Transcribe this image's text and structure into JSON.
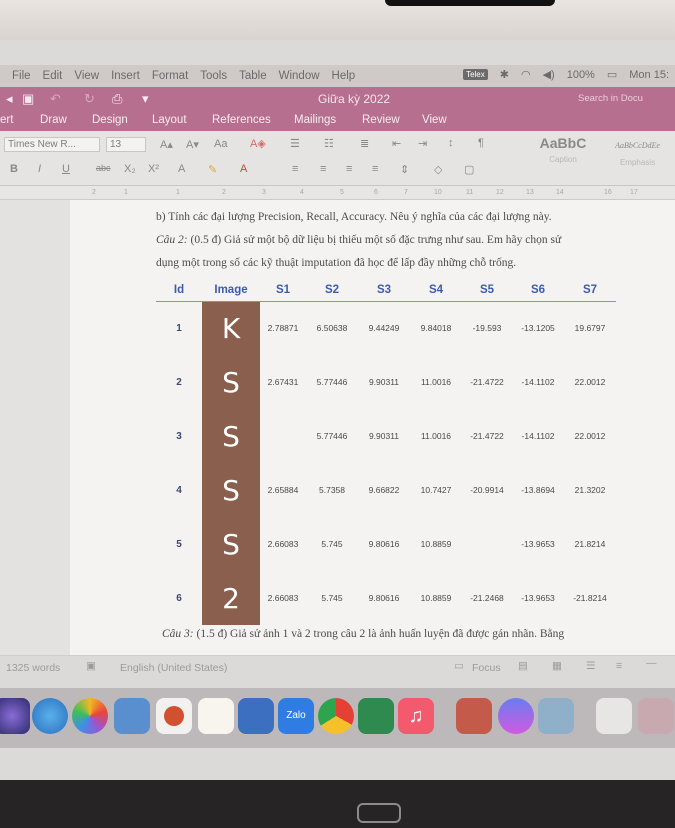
{
  "menubar": {
    "items": [
      "File",
      "Edit",
      "View",
      "Insert",
      "Format",
      "Tools",
      "Table",
      "Window",
      "Help"
    ],
    "input_method": "Telex",
    "battery": "100%",
    "clock": "Mon 15:"
  },
  "window": {
    "title": "Giữa kỳ 2022",
    "search_placeholder": "Search in Docu"
  },
  "ribbon": {
    "tabs": [
      "ert",
      "Draw",
      "Design",
      "Layout",
      "References",
      "Mailings",
      "Review",
      "View"
    ],
    "font_name": "Times New R...",
    "font_size": "13",
    "styles": [
      {
        "preview": "AaBbC",
        "name": "Caption"
      },
      {
        "preview": "AaBbCcDdEe",
        "name": "Emphasis"
      }
    ]
  },
  "document": {
    "line_b": "b) Tính các đại lượng Precision, Recall, Accuracy. Nêu ý nghĩa của các đại lượng này.",
    "cau2_label": "Câu 2:",
    "cau2_line1": " (0.5 đ) Giả sử một bộ dữ liệu bị thiếu một số đặc trưng như sau. Em hãy chọn sử",
    "cau2_line2": "dụng một trong số các kỹ thuật imputation đã học để lấp đầy những chỗ trống.",
    "table": {
      "headers": [
        "Id",
        "Image",
        "S1",
        "S2",
        "S3",
        "S4",
        "S5",
        "S6",
        "S7"
      ],
      "rows": [
        {
          "id": "1",
          "image": "K",
          "s": [
            "2.78871",
            "6.50638",
            "9.44249",
            "9.84018",
            "-19.593",
            "-13.1205",
            "19.6797"
          ]
        },
        {
          "id": "2",
          "image": "S",
          "s": [
            "2.67431",
            "5.77446",
            "9.90311",
            "11.0016",
            "-21.4722",
            "-14.1102",
            "22.0012"
          ]
        },
        {
          "id": "3",
          "image": "S",
          "s": [
            "",
            "5.77446",
            "9.90311",
            "11.0016",
            "-21.4722",
            "-14.1102",
            "22.0012"
          ]
        },
        {
          "id": "4",
          "image": "S",
          "s": [
            "2.65884",
            "5.7358",
            "9.66822",
            "10.7427",
            "-20.9914",
            "-13.8694",
            "21.3202"
          ]
        },
        {
          "id": "5",
          "image": "S",
          "s": [
            "2.66083",
            "5.745",
            "9.80616",
            "10.8859",
            "",
            "-13.9653",
            "21.8214"
          ]
        },
        {
          "id": "6",
          "image": "2",
          "s": [
            "2.66083",
            "5.745",
            "9.80616",
            "10.8859",
            "-21.2468",
            "-13.9653",
            "-21.8214"
          ]
        }
      ]
    },
    "cau3_label": "Câu 3:",
    "cau3_line": " (1.5 đ) Giả sử ảnh 1 và 2 trong câu 2 là ảnh huấn luyện đã được gán nhãn. Bằng"
  },
  "statusbar": {
    "word_count": "1325 words",
    "language": "English (United States)",
    "focus": "Focus"
  },
  "dock": {
    "apps": [
      "Siri",
      "Safari",
      "Photos",
      "Preview",
      "PowerPoint",
      "Notes",
      "Word",
      "Zalo",
      "Chrome",
      "Excel",
      "Music",
      "Dictionary",
      "Messenger",
      "Finder",
      "Screenshot",
      "Gallery"
    ]
  }
}
